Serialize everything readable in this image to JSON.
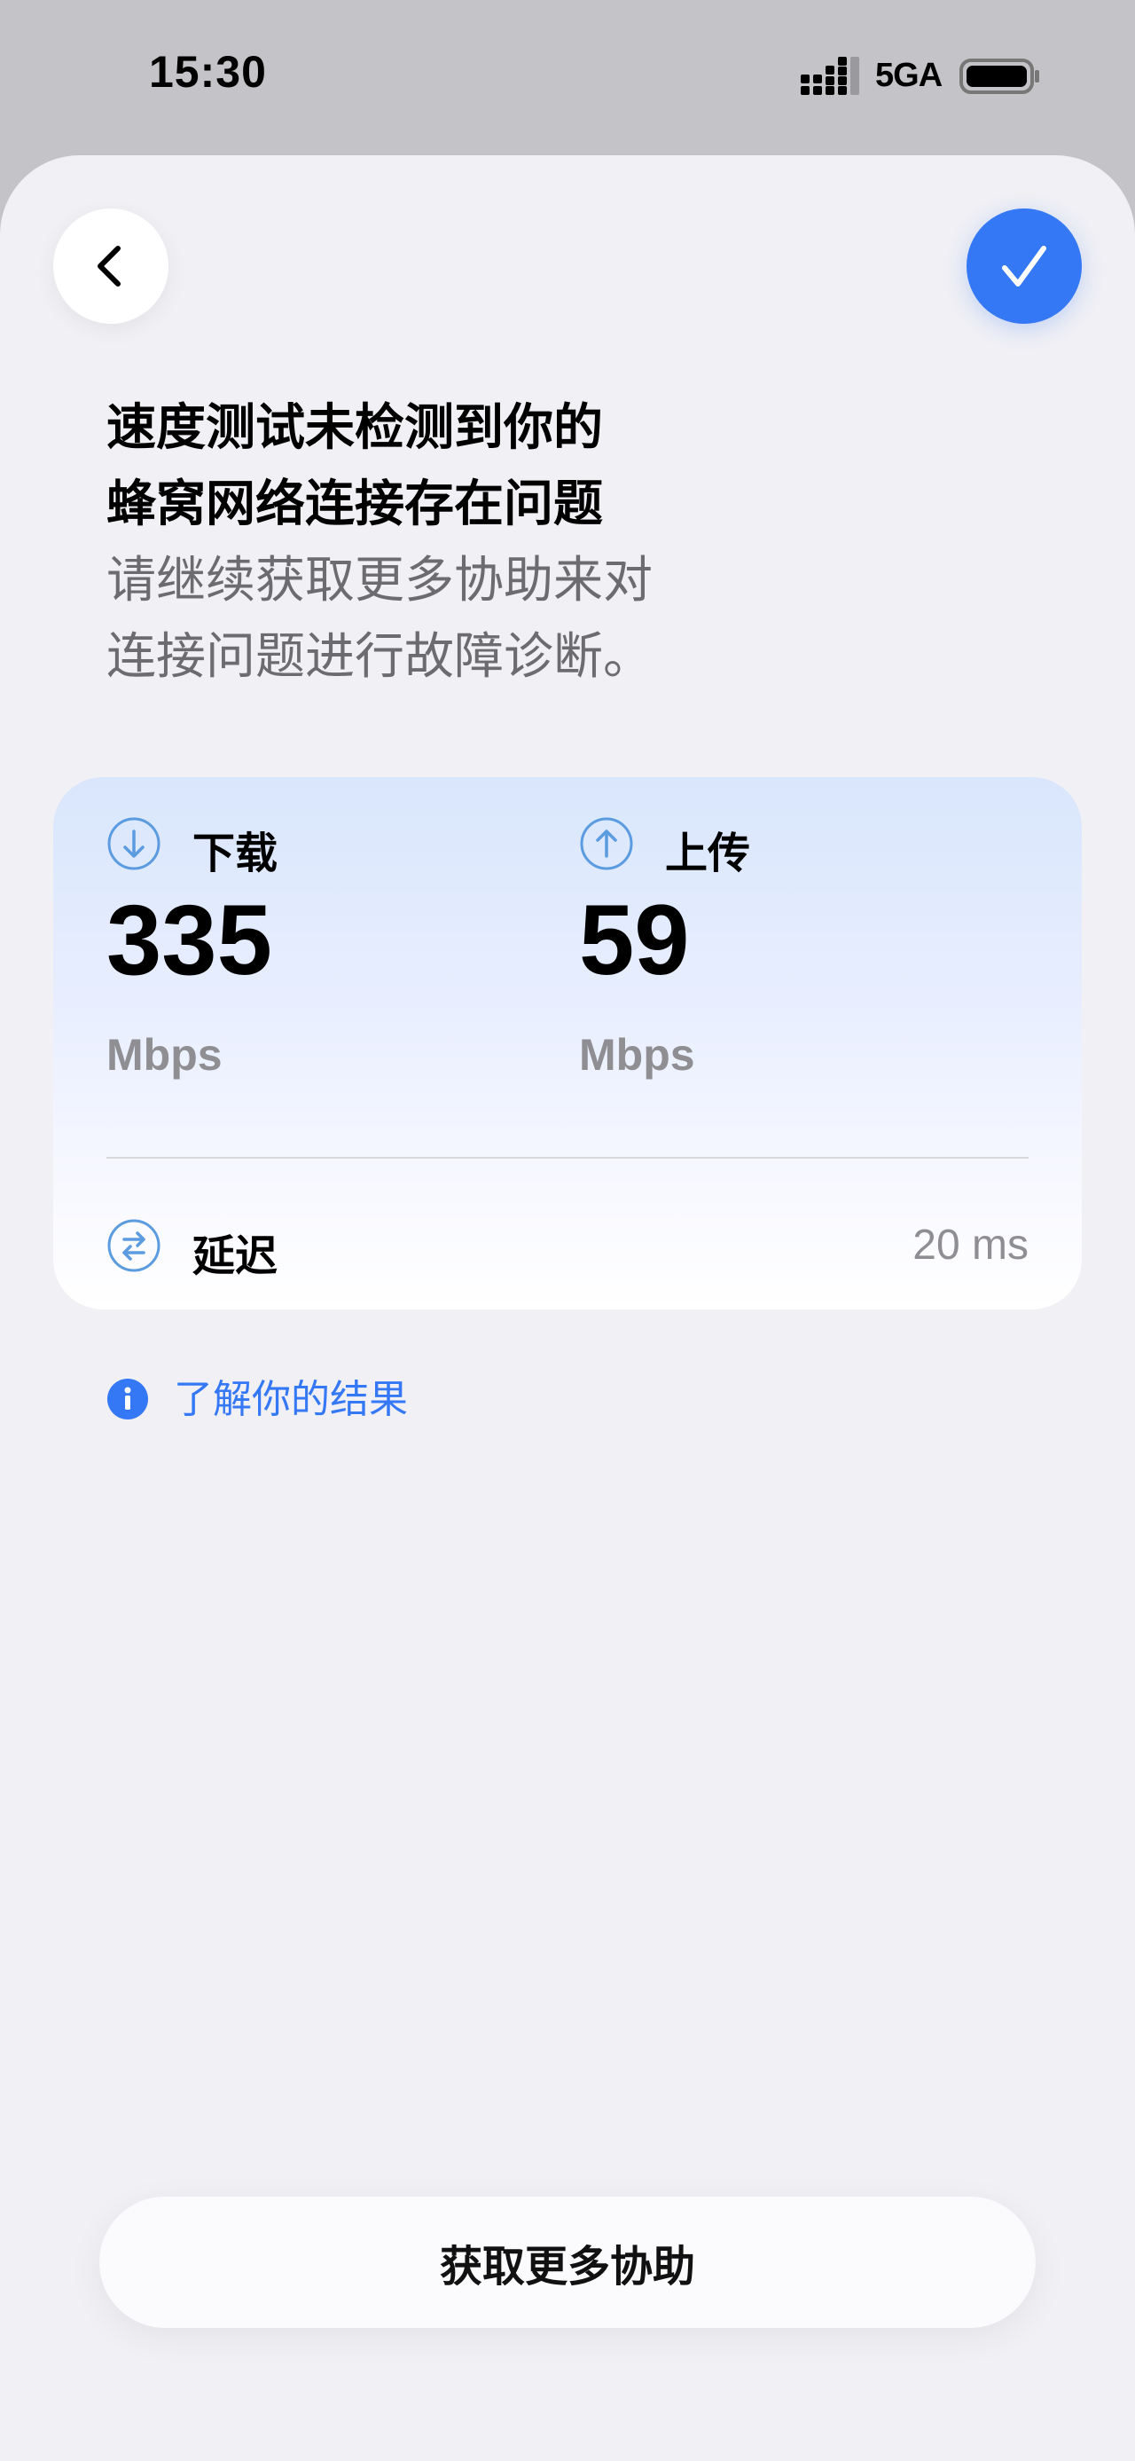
{
  "status_bar": {
    "time": "15:30",
    "network": "5GA",
    "signal_icon": "cellular-signal-icon",
    "battery_icon": "battery-icon"
  },
  "nav": {
    "back_icon": "chevron-left-icon",
    "done_icon": "checkmark-icon"
  },
  "headline": {
    "title": "速度测试未检测到你的\n蜂窝网络连接存在问题",
    "subtitle": "请继续获取更多协助来对\n连接问题进行故障诊断。"
  },
  "results": {
    "download": {
      "label": "下载",
      "value": "335",
      "unit": "Mbps",
      "icon": "arrow-down-circle-icon"
    },
    "upload": {
      "label": "上传",
      "value": "59",
      "unit": "Mbps",
      "icon": "arrow-up-circle-icon"
    },
    "latency": {
      "label": "延迟",
      "value": "20 ms",
      "icon": "arrows-swap-circle-icon"
    }
  },
  "info_link": {
    "label": "了解你的结果",
    "icon": "info-circle-icon"
  },
  "primary_button": {
    "label": "获取更多协助"
  },
  "colors": {
    "accent": "#3478f6",
    "background": "#f0f0f5",
    "secondary_text": "#8e8e93"
  }
}
